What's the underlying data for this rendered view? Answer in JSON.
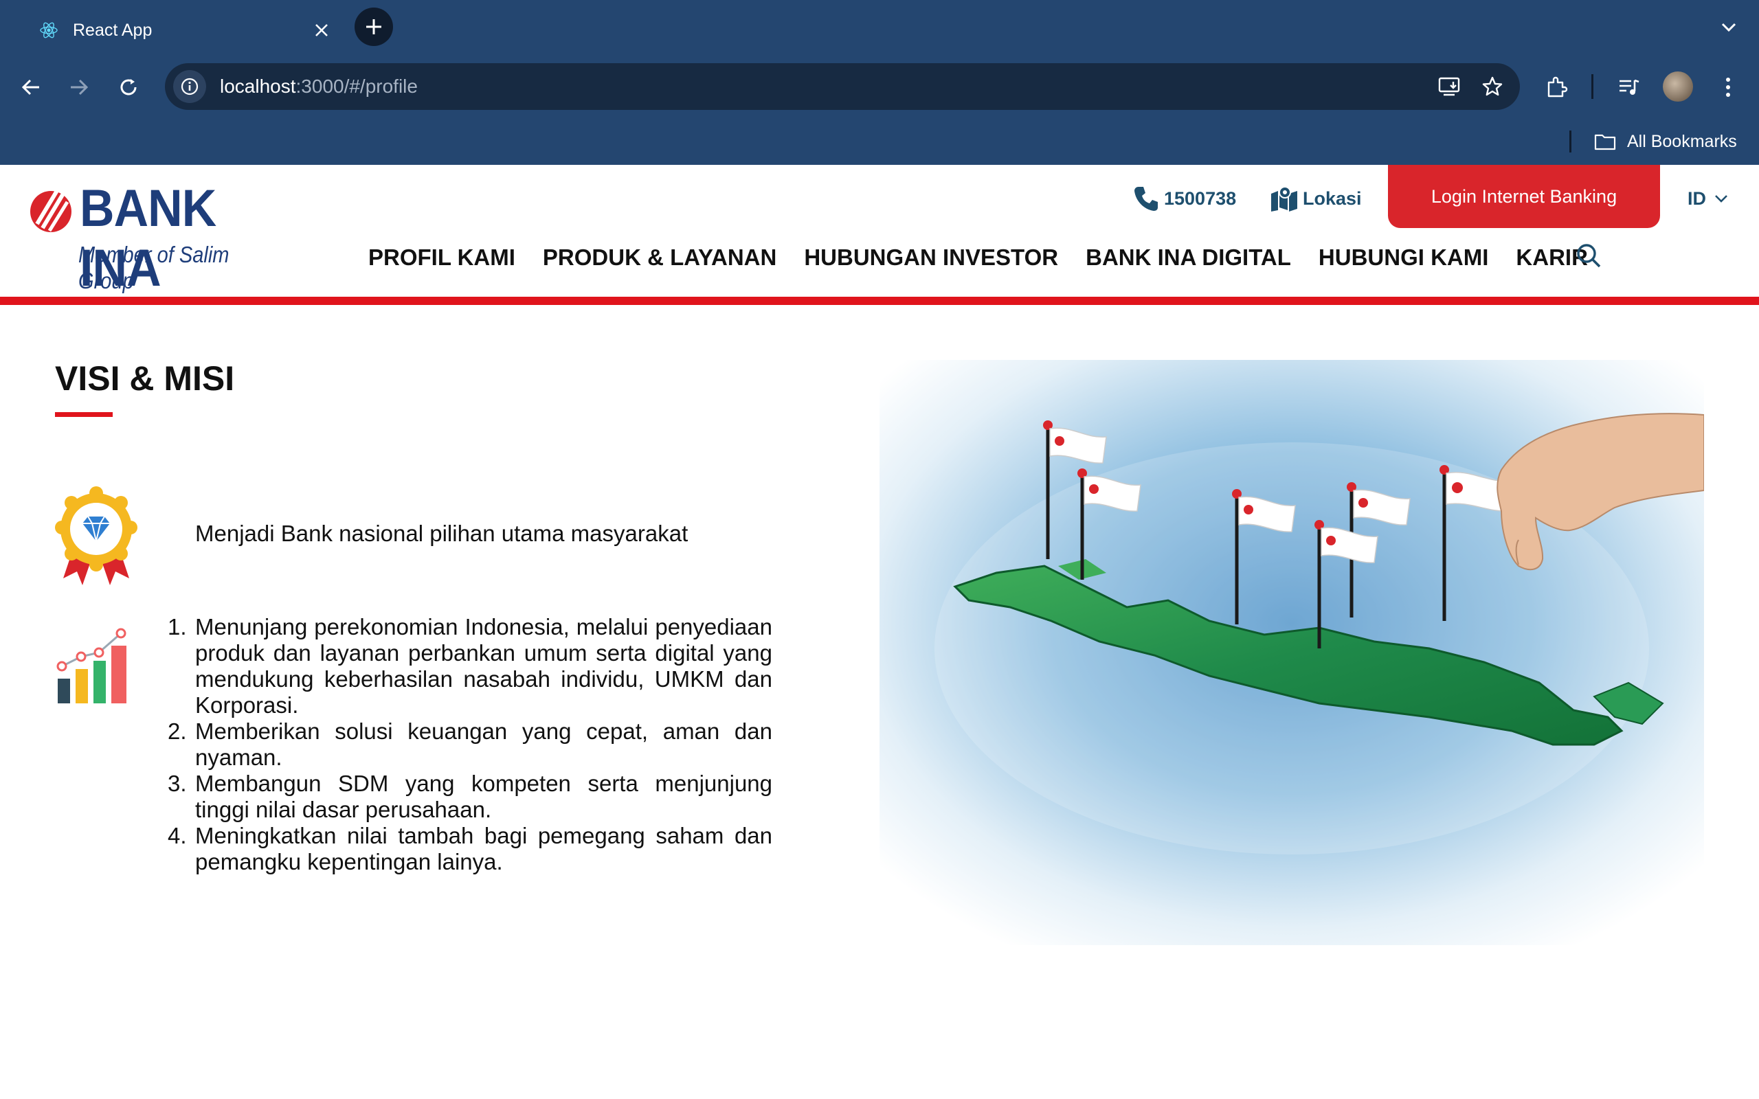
{
  "browser": {
    "tab_title": "React App",
    "url_host": "localhost",
    "url_rest": ":3000/#/profile",
    "bookmarks_label": "All Bookmarks"
  },
  "header": {
    "logo_name": "BANK INA",
    "logo_tagline": "Member of Salim Group",
    "phone": "1500738",
    "location_label": "Lokasi",
    "login_label": "Login Internet Banking",
    "language": "ID",
    "menu": [
      {
        "label": "PROFIL KAMI"
      },
      {
        "label": "PRODUK & LAYANAN"
      },
      {
        "label": "HUBUNGAN INVESTOR"
      },
      {
        "label": "BANK INA DIGITAL"
      },
      {
        "label": "HUBUNGI KAMI"
      },
      {
        "label": "KARIR"
      }
    ]
  },
  "content": {
    "title": "VISI & MISI",
    "visi": "Menjadi Bank nasional pilihan utama masyarakat",
    "misi": [
      "Menunjang perekonomian Indonesia, melalui penyediaan produk dan layanan perbankan umum serta digital yang mendukung keberhasilan nasabah individu, UMKM dan Korporasi.",
      "Memberikan solusi keuangan yang cepat, aman dan nyaman.",
      "Membangun SDM yang kompeten serta menjunjung tinggi nilai dasar perusahaan.",
      "Meningkatkan nilai tambah bagi pemegang saham dan pemangku kepentingan lainya."
    ]
  },
  "colors": {
    "chrome": "#244670",
    "brand_red": "#e0141c",
    "brand_blue": "#1e3d7a",
    "contact_teal": "#1e4f6e"
  }
}
